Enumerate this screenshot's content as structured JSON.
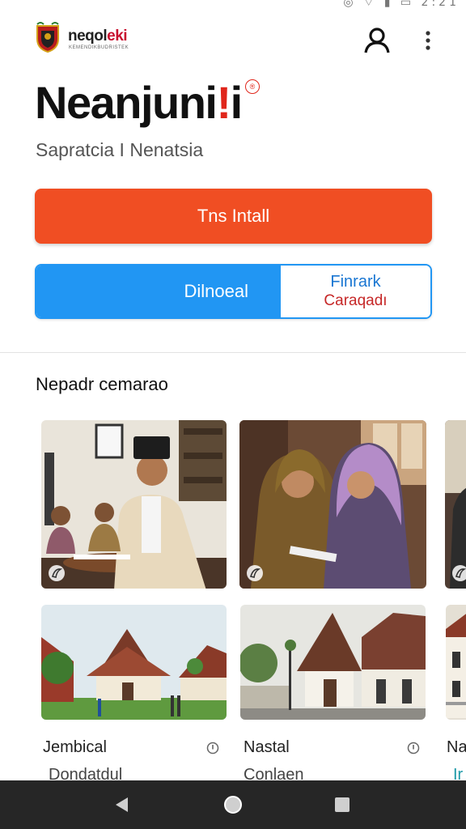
{
  "status_bar": {
    "icons": [
      "notification-icon",
      "wifi-icon",
      "signal-icon",
      "battery-icon"
    ],
    "time": "2:21"
  },
  "header": {
    "brand_prefix": "neqol",
    "brand_suffix": "eki",
    "brand_tagline": "KEMENDIKBUDRISTEK"
  },
  "hero": {
    "title_main": "Neanjuni",
    "title_accent": "!",
    "title_tail": "i",
    "reg_mark": "®",
    "subtitle": "Sapratcia I Nenatsia"
  },
  "buttons": {
    "install_label": "Tns Intall",
    "left_label": "Dilnoeal",
    "right_line1": "Finrark",
    "right_line2": "Caraqadı"
  },
  "section": {
    "title": "Nepadr cemarao"
  },
  "places": [
    {
      "name": "Jembical",
      "sub": "Dondatdul"
    },
    {
      "name": "Nastal",
      "sub": "Conlaen"
    },
    {
      "name": "Na",
      "sub": "Ir"
    }
  ],
  "colors": {
    "accent_orange": "#f04e23",
    "accent_blue": "#2196f3",
    "brand_red": "#e0261b",
    "nav_bg": "#262626"
  }
}
